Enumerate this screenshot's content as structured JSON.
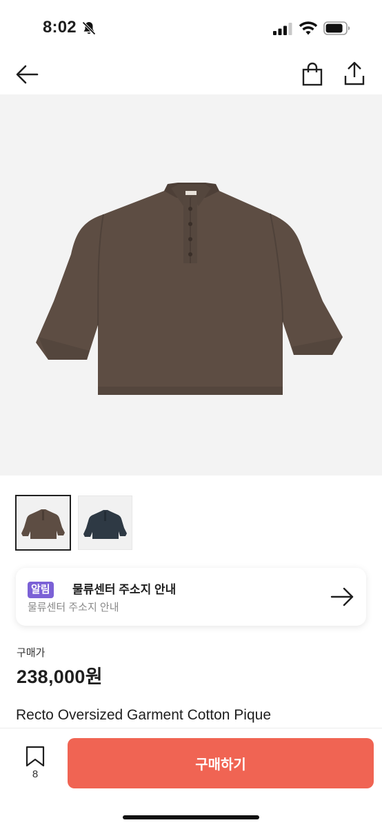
{
  "status_bar": {
    "time": "8:02",
    "icons": [
      "bell-off-icon",
      "signal-icon",
      "wifi-icon",
      "battery-icon"
    ]
  },
  "nav": {
    "icons": [
      "back-arrow-icon",
      "shopping-bag-icon",
      "share-icon"
    ]
  },
  "product": {
    "images": [
      {
        "color": "#5b4c43",
        "label": "brown"
      },
      {
        "color": "#2f3a46",
        "label": "navy"
      }
    ],
    "selected_image_index": 0
  },
  "notice": {
    "badge": "알림",
    "title": "물류센터 주소지 안내",
    "subtitle": "물류센터 주소지 안내"
  },
  "price": {
    "label": "구매가",
    "value": "238,000원"
  },
  "product_name": "Recto Oversized Garment Cotton Pique",
  "bottom_bar": {
    "bookmark_count": "8",
    "buy_label": "구매하기",
    "accent_color": "#f06453"
  }
}
